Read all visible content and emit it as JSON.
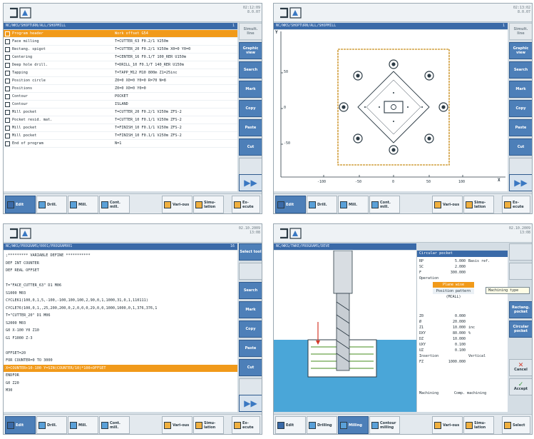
{
  "colors": {
    "accent": "#f19a1a",
    "softkey": "#4d7fb8",
    "path_bar": "#3a6aa8",
    "canvas": "#ffffff"
  },
  "panel1": {
    "path": "NC/WKS/SHOPTURN/ALL/SHOPMILL",
    "path_num": "1",
    "clock": [
      "02:12:09",
      "8.0.07"
    ],
    "list": [
      {
        "icon": "program-header-icon",
        "name": "Program header",
        "params": "Work offset G54"
      },
      {
        "icon": "face-milling-icon",
        "name": "Face milling",
        "params": "T=CUTTER_63 F0.2/1 V250m"
      },
      {
        "icon": "rectangular-spigot-icon",
        "name": "Rectang. spigot",
        "params": "T=CUTTER_20 F0.2/1 V250m X0=0 Y0=0"
      },
      {
        "icon": "centering-icon",
        "name": "Centering",
        "params": "T=CENTER_16 F0.1/T 100_RER U150m"
      },
      {
        "icon": "deep-hole-drill-icon",
        "name": "Deep hole drill.",
        "params": "T=DRILL_10 F0.1/T 140_RER U150m"
      },
      {
        "icon": "tapping-icon",
        "name": "Tapping",
        "params": "T=TAPP_M12 M10 800m Z1=25inc"
      },
      {
        "icon": "position-circle-icon",
        "name": "Position circle",
        "params": "Z0=0 X0=0 Y0=0 R=70 N=8"
      },
      {
        "icon": "positions-icon",
        "name": "Positions",
        "params": "Z0=0 X0=0 Y0=0"
      },
      {
        "icon": "contour-icon",
        "name": "Contour",
        "params": "POCKET"
      },
      {
        "icon": "contour-icon",
        "name": "Contour",
        "params": "ISLAND"
      },
      {
        "icon": "mill-pocket-icon",
        "name": "Mill pocket",
        "params": "T=CUTTER_20 F0.2/1 V250m ZFS-2"
      },
      {
        "icon": "pocket-resid-icon",
        "name": "Pocket resid. mat.",
        "params": "T=CUTTER_10 F0.1/1 V250m ZFS-2"
      },
      {
        "icon": "mill-pocket-icon",
        "name": "Mill pocket",
        "params": "T=FINISH_10 F0.1/1 V250m ZFS-2"
      },
      {
        "icon": "mill-pocket-icon",
        "name": "Mill pocket",
        "params": "T=FINISH_10 F0.1/1 V250m ZFS-2"
      },
      {
        "icon": "end-of-program-icon",
        "name": "End of program",
        "params": "N=1"
      }
    ],
    "softkeys": [
      "Graphic view",
      "Search",
      "Mark",
      "Copy",
      "Paste",
      "Cut"
    ],
    "softkey_top": "Simult. line"
  },
  "panel2": {
    "path": "NC/WKS/SHOPTURN/ALL/SHOPMILL",
    "path_num": "1",
    "clock": [
      "02:13:02",
      "8.0.07"
    ],
    "axis_y_label": "Y",
    "axis_x_label": "X",
    "y_ticks": [
      "50",
      "0",
      "-50"
    ],
    "x_ticks": [
      "-100",
      "-50",
      "0",
      "50",
      "100"
    ],
    "softkeys": [
      "Graphic view",
      "Search",
      "Mark",
      "Copy",
      "Paste",
      "Cut"
    ],
    "softkey_top": "Simult. line"
  },
  "panel3": {
    "path": "NC/WKS/PROGRAMS/0001/PROGRAM001",
    "path_num": "16",
    "clock": [
      "02.10.2009",
      "13:08"
    ],
    "code": [
      ";********* VARIABLE DEFINE ***********",
      "DEF INT COUNTER",
      "DEF REAL OFFSET",
      "",
      "T=\"FACE_CUTTER_63\" D1 M06",
      "S1000 M03",
      "CYCLE61(100,0,1,5,-100,-100,100,100,2,90,0,1,1000,31,0,1,110111)",
      "CYCLE76(100,0,1,,25,200,200,0,2,0,0,0,29,0,0,1000,1000,0,1,376,376,1",
      "T=\"CUTTER_20\" D1 M06",
      "S2000 M03",
      "G0 X-100 Y0 Z10",
      "G1 F1000 Z-3",
      "",
      "OFFSET=20",
      "FOR COUNTER=0 TO 3000",
      "  X=COUNTER+10-100 Y=SIN(COUNTER/10)*100+OFFSET",
      "ENDFOR",
      "G0 Z20",
      "M30"
    ],
    "selected_line": 15,
    "softkeys": [
      "Search",
      "Mark",
      "Copy",
      "Paste",
      "Cut"
    ],
    "softkey_top": "Select tool"
  },
  "panel4": {
    "path": "NC/WKS/TWKE/PROGRAMS/DEVE",
    "clock": [
      "02.10.2009",
      "13:08"
    ],
    "form_title": "Circular pocket",
    "rows_top": [
      {
        "k": "RP",
        "v": "5.000",
        "u": "Basis ref."
      },
      {
        "k": "SC",
        "v": "2.000",
        "u": ""
      },
      {
        "k": "F",
        "v": "300.000",
        "u": ""
      }
    ],
    "operation_label": "Operation",
    "operation_value": "Plane wise",
    "pattern_value": "Position pattern (MCALL)",
    "rows_bottom": [
      {
        "k": "Z0",
        "v": "0.000",
        "u": ""
      },
      {
        "k": "Ø",
        "v": "20.000",
        "u": ""
      },
      {
        "k": "Z1",
        "v": "10.000",
        "u": "inc"
      },
      {
        "k": "DXY",
        "v": "80.000",
        "u": "%"
      },
      {
        "k": "DZ",
        "v": "10.000",
        "u": ""
      },
      {
        "k": "UXY",
        "v": "0.100",
        "u": ""
      },
      {
        "k": "UZ",
        "v": "0.100",
        "u": ""
      },
      {
        "k": "Insertion",
        "v": "",
        "u": "Vertical"
      },
      {
        "k": "FZ",
        "v": "1000.000",
        "u": ""
      }
    ],
    "machining_label": "Machining",
    "machining_value": "Comp. machining",
    "tooltip": "Machining type",
    "softkeys": [
      "Rectang. pocket",
      "Circular pocket"
    ],
    "cancel_label": "Cancel",
    "accept_label": "Accept"
  },
  "bottom_keys_1": [
    "Edit",
    "Drill.",
    "Mill.",
    "Cont. mill.",
    "Vari-ous",
    "Simu-lation",
    "Ex-ecute"
  ],
  "bottom_keys_3": [
    "Edit",
    "Drill.",
    "Mill.",
    "Cont. mill.",
    "Vari-ous",
    "Simu-lation",
    "Ex-ecute"
  ],
  "bottom_keys_4": [
    "Edit",
    "Drilling",
    "Milling",
    "Contour milling",
    "Vari-ous",
    "Simu-lation",
    "Select"
  ]
}
